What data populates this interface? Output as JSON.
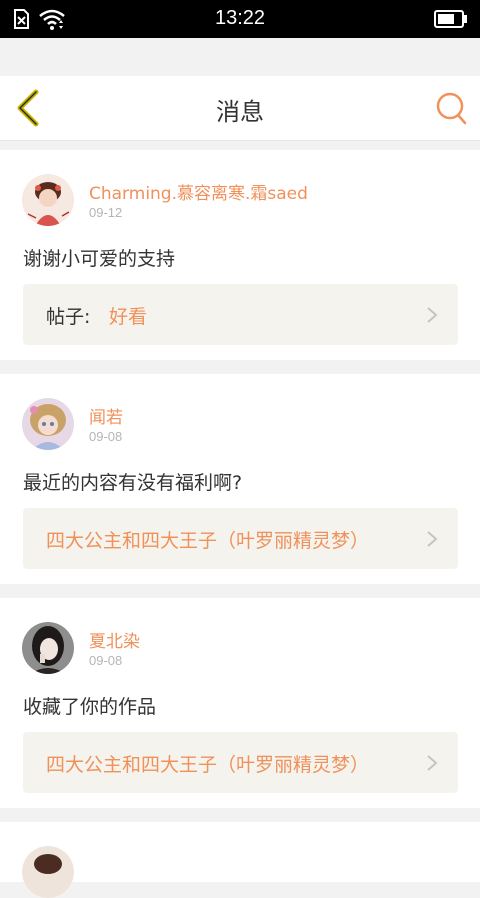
{
  "status_bar": {
    "time": "13:22",
    "icons": [
      "no-sim-icon",
      "wifi-icon",
      "battery-icon"
    ]
  },
  "header": {
    "title": "消息",
    "back_icon": "chevron-left-icon",
    "search_icon": "search-icon"
  },
  "colors": {
    "accent": "#f0915a",
    "back_icon": "#c8b400",
    "text": "#333333",
    "muted": "#b5b5b5",
    "link_bg": "#f5f3ee",
    "background": "#f2f2f2"
  },
  "messages": [
    {
      "name": "Charming.慕容离寒.霜saed",
      "date": "09-12",
      "content": "谢谢小可爱的支持",
      "post_prefix": "帖子:",
      "post_title": "好看"
    },
    {
      "name": "闻若",
      "date": "09-08",
      "content": "最近的内容有没有福利啊?",
      "post_prefix": "",
      "post_title": "四大公主和四大王子（叶罗丽精灵梦）"
    },
    {
      "name": "夏北染",
      "date": "09-08",
      "content": "收藏了你的作品",
      "post_prefix": "",
      "post_title": "四大公主和四大王子（叶罗丽精灵梦）"
    }
  ]
}
